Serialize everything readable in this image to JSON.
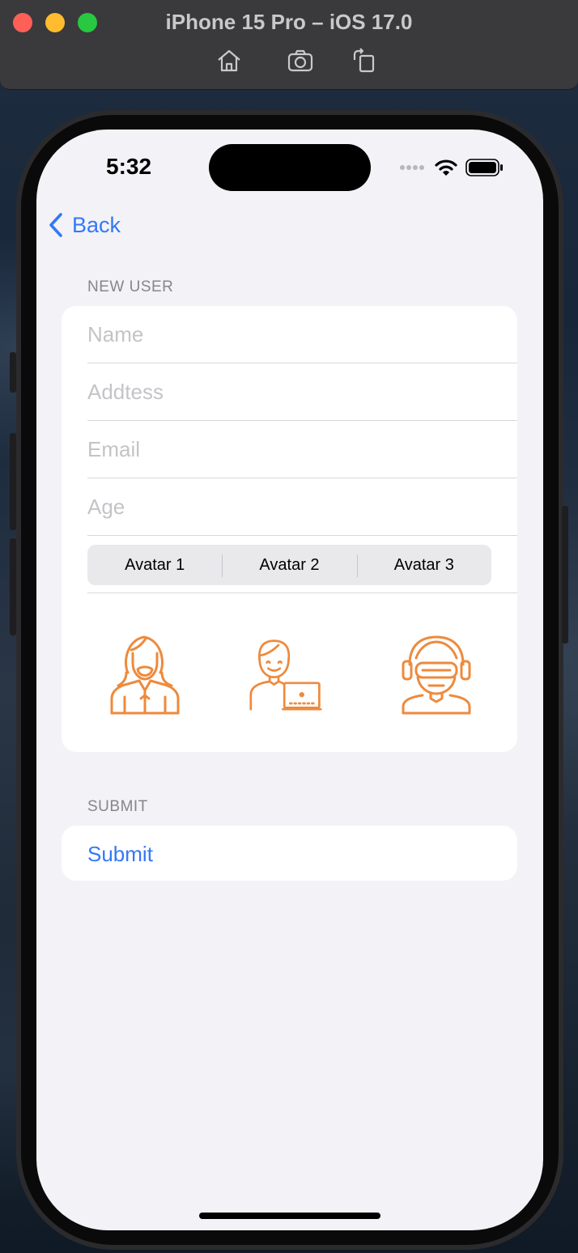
{
  "window": {
    "title": "iPhone 15 Pro – iOS 17.0",
    "toolbar_icons": [
      "home-icon",
      "screenshot-icon",
      "rotate-icon"
    ]
  },
  "status_bar": {
    "time": "5:32",
    "icons": [
      "cellular-dots-icon",
      "wifi-icon",
      "battery-icon"
    ]
  },
  "nav": {
    "back_label": "Back"
  },
  "form": {
    "section_header": "NEW USER",
    "fields": [
      {
        "name": "name",
        "placeholder": "Name",
        "value": ""
      },
      {
        "name": "address",
        "placeholder": "Addtess",
        "value": ""
      },
      {
        "name": "email",
        "placeholder": "Email",
        "value": ""
      },
      {
        "name": "age",
        "placeholder": "Age",
        "value": ""
      }
    ],
    "segments": [
      "Avatar 1",
      "Avatar 2",
      "Avatar 3"
    ],
    "avatars": [
      "long-hair-bearded-person-icon",
      "person-with-laptop-icon",
      "person-with-vr-headset-icon"
    ],
    "avatar_color": "#ee8a3c"
  },
  "submit": {
    "section_header": "SUBMIT",
    "button_label": "Submit"
  },
  "colors": {
    "accent": "#3478f6",
    "background": "#f2f2f7",
    "placeholder": "#c4c4c8"
  }
}
